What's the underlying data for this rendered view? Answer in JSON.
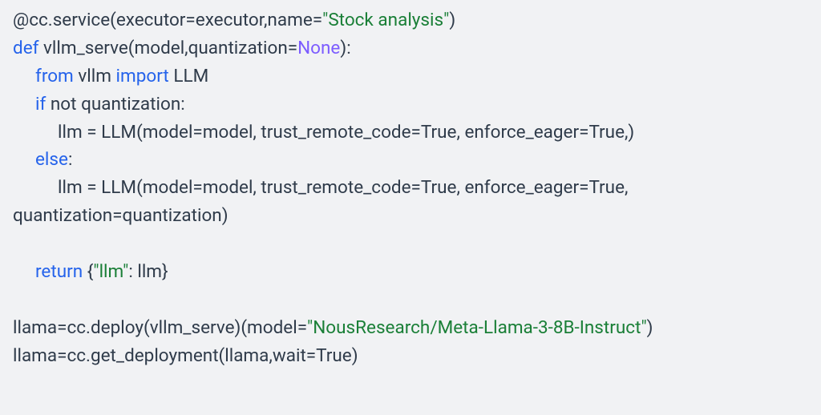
{
  "code": {
    "line1": {
      "t1": "@cc.service(executor=executor,name=",
      "s1": "\"Stock analysis\"",
      "t2": ")"
    },
    "line2": {
      "kw1": "def",
      "t1": " vllm_serve(model,quantization=",
      "nn1": "None",
      "t2": "):"
    },
    "line3": {
      "kw1": "from",
      "t1": " vllm ",
      "kw2": "import",
      "t2": " LLM"
    },
    "line4": {
      "kw1": "if",
      "t1": " not quantization:"
    },
    "line5": {
      "t1": "llm = LLM(model=model, trust_remote_code=True, enforce_eager=True,)"
    },
    "line6": {
      "kw1": "else",
      "t1": ":"
    },
    "line7": {
      "t1": "llm = LLM(model=model, trust_remote_code=True, enforce_eager=True,"
    },
    "line8": {
      "t1": "quantization=quantization)"
    },
    "blank": " ",
    "line10": {
      "kw1": "return",
      "t1": " {",
      "s1": "\"llm\"",
      "t2": ": llm}"
    },
    "line12": {
      "t1": "llama=cc.deploy(vllm_serve)(model=",
      "s1": "\"NousResearch/Meta-Llama-3-8B-Instruct\"",
      "t2": ")"
    },
    "line13": {
      "t1": "llama=cc.get_deployment(llama,wait=True)"
    }
  }
}
